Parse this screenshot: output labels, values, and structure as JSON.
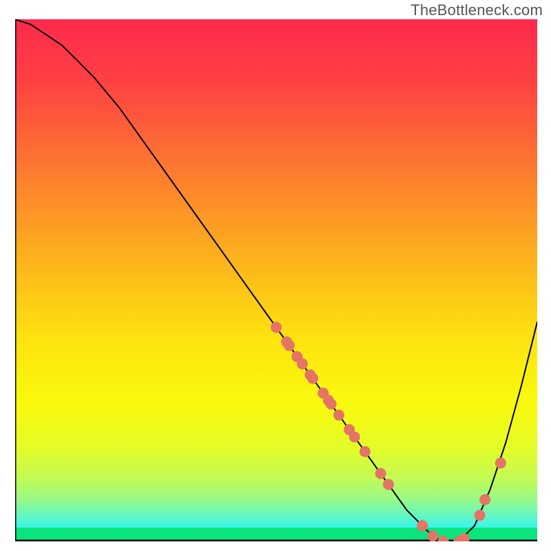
{
  "watermark": "TheBottleneck.com",
  "chart_data": {
    "type": "line",
    "title": "",
    "xlabel": "",
    "ylabel": "",
    "xlim": [
      0,
      100
    ],
    "ylim": [
      0,
      100
    ],
    "legend": false,
    "grid": false,
    "background": "vertical-gradient red→yellow→green",
    "curve": {
      "x": [
        0,
        3,
        6,
        9,
        12,
        15,
        20,
        25,
        30,
        35,
        40,
        45,
        50,
        55,
        60,
        65,
        70,
        75,
        78,
        80,
        82,
        85,
        88,
        91,
        94,
        97,
        100
      ],
      "y": [
        100,
        99,
        97,
        95,
        92,
        89,
        83,
        76,
        69,
        62,
        55,
        48,
        41,
        34,
        27,
        20,
        13,
        6,
        3,
        1,
        0,
        0,
        3,
        10,
        19,
        30,
        42
      ]
    },
    "scatter": {
      "x": [
        50,
        52,
        52.5,
        54,
        55,
        56.5,
        57,
        59,
        60,
        60.5,
        62,
        64,
        65,
        67,
        70,
        71.5,
        78,
        80,
        82,
        85,
        86,
        89,
        90,
        93
      ],
      "y": [
        41,
        38.2,
        37.5,
        35.4,
        34,
        31.9,
        31.2,
        28.4,
        27,
        26.3,
        24.2,
        21.4,
        20,
        17.2,
        13,
        10.9,
        3,
        1,
        0,
        0,
        0.5,
        5,
        8,
        15
      ]
    },
    "point_color": "#e57366",
    "line_color": "#000000"
  }
}
